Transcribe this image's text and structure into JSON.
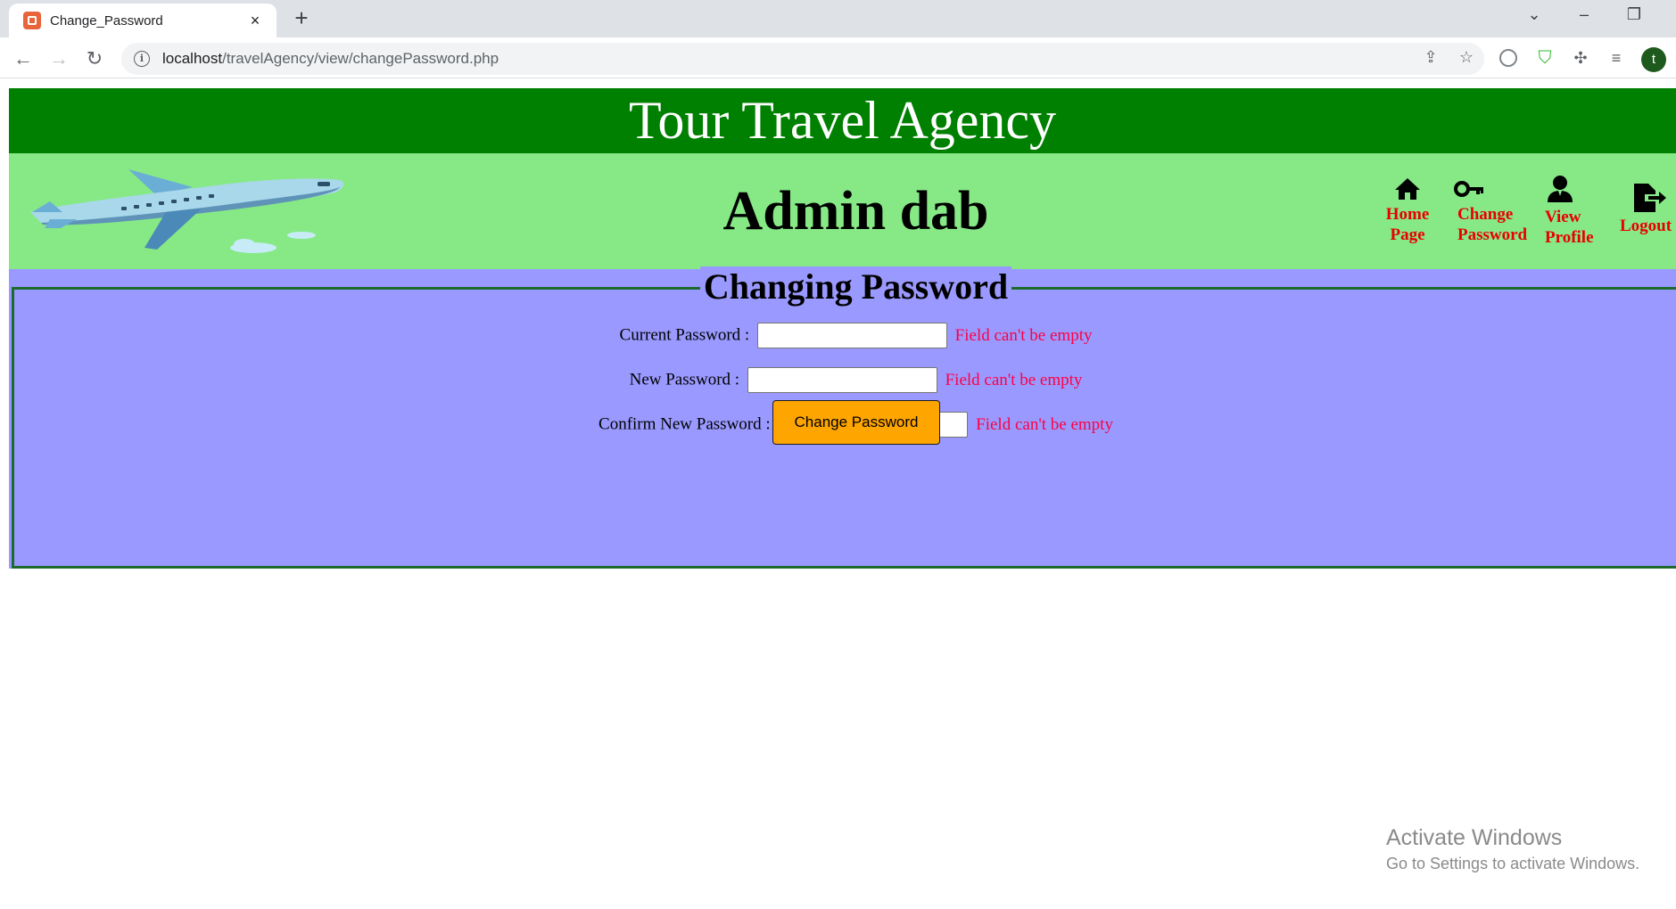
{
  "browser": {
    "tab_title": "Change_Password",
    "tab_close_icon": "×",
    "new_tab_icon": "+",
    "url_host": "localhost",
    "url_path": "/travelAgency/view/changePassword.php",
    "avatar_letter": "t"
  },
  "site": {
    "title": "Tour Travel Agency",
    "admin_name": "Admin dab",
    "nav": {
      "home_line1": "Home",
      "home_line2": "Page",
      "change_line1": "Change",
      "change_line2": "Password",
      "profile_line1": "View",
      "profile_line2": "Profile",
      "logout": "Logout"
    }
  },
  "form": {
    "legend": "Changing Password",
    "current_label": "Current Password :",
    "new_label": "New Password :",
    "confirm_label": "Confirm New Password :",
    "current_error": "Field can't be empty",
    "new_error": "Field can't be empty",
    "confirm_error": "Field can't be empty",
    "submit_label": "Change Password"
  },
  "watermark": {
    "line1": "Activate Windows",
    "line2": "Go to Settings to activate Windows."
  },
  "colors": {
    "header_bg": "#008000",
    "subheader_bg": "#86e986",
    "main_bg": "#9999ff",
    "nav_text": "#e80000",
    "error_text": "#ff0044",
    "button_bg": "#ffa500"
  }
}
